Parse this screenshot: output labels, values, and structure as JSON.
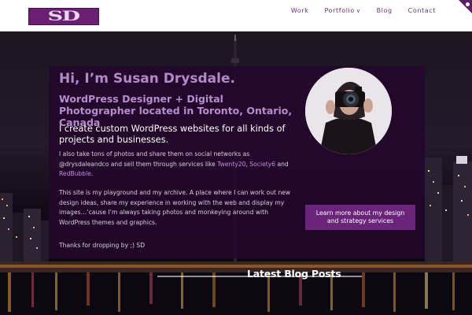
{
  "header": {
    "logo_text": "SD",
    "nav": [
      {
        "label": "Work"
      },
      {
        "label": "Portfolio"
      },
      {
        "label": "Blog"
      },
      {
        "label": "Contact"
      }
    ]
  },
  "hero": {
    "greeting": "Hi, I’m Susan Drysdale.",
    "subtitle": "WordPress Designer + Digital Photographer located in Toronto, Ontario, Canada",
    "lead": "I create custom WordPress websites for all kinds of projects and businesses.",
    "p1_start": "I also take tons of photos and share them on social networks as @drysdaleandco and sell them through services like ",
    "link_twenty20": "Twenty20",
    "sep1": ", ",
    "link_society6": "Society6",
    "and_text": " and ",
    "link_redbubble": "RedBubble",
    "end_dot": ".",
    "p2": "This site is my playground and my archive. A place where I can work out new design ideas, share my experience in working with the web and display my images…’cause I’m always taking photos and monkeying around with WordPress themes and graphics.",
    "p3": "Thanks for dropping by ;) SD",
    "cta_label": "Learn more about my design and strategy services"
  },
  "section": {
    "latest_heading": "Latest Blog Posts"
  },
  "colors": {
    "brand": "#6b1f72",
    "accent": "#b98bd0",
    "cta": "#6a2479"
  },
  "icons": {
    "portfolio_dropdown": "chevron-down-icon",
    "corner": "corner-ribbon-icon"
  }
}
